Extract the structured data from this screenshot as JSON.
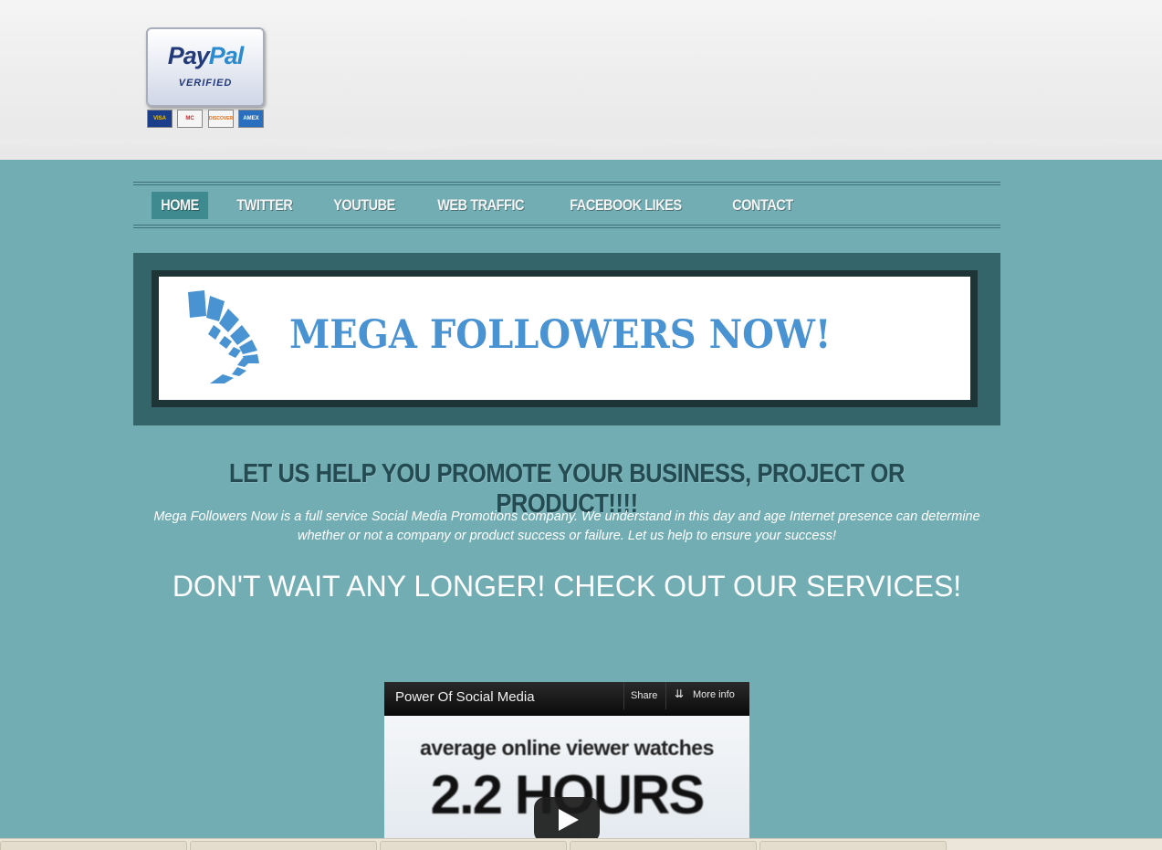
{
  "header": {
    "paypal": {
      "word_pay": "Pay",
      "word_pal": "Pal",
      "verified": "VERIFIED",
      "cards": [
        "VISA",
        "MC",
        "DISCOVER",
        "AMEX"
      ]
    }
  },
  "nav": {
    "items": [
      {
        "label": "HOME",
        "active": true
      },
      {
        "label": "TWITTER",
        "active": false
      },
      {
        "label": "YOUTUBE",
        "active": false
      },
      {
        "label": "WEB TRAFFIC",
        "active": false
      },
      {
        "label": "FACEBOOK LIKES",
        "active": false
      },
      {
        "label": "CONTACT",
        "active": false
      }
    ]
  },
  "banner": {
    "title": "MEGA FOLLOWERS NOW!",
    "logo_icon": "fan-blocks-icon"
  },
  "main": {
    "headline": "LET US HELP YOU PROMOTE YOUR BUSINESS, PROJECT OR PRODUCT!!!!",
    "intro": "Mega Followers Now is a full service Social Media Promotions company. We understand in this day and age Internet presence can determine whether or not a company or product success or failure. Let us help to ensure your success!",
    "cta": "DON'T WAIT ANY LONGER! CHECK OUT OUR SERVICES!"
  },
  "video": {
    "title": "Power Of Social Media",
    "share_label": "Share",
    "more_info_label": "More info",
    "frame_text_line1": "average online viewer watches",
    "frame_text_line2": "2.2 HOURS"
  },
  "colors": {
    "page_bg": "#72adb3",
    "nav_active": "#3e8a8f",
    "banner_title": "#4a93d2",
    "headline": "#244a52"
  }
}
